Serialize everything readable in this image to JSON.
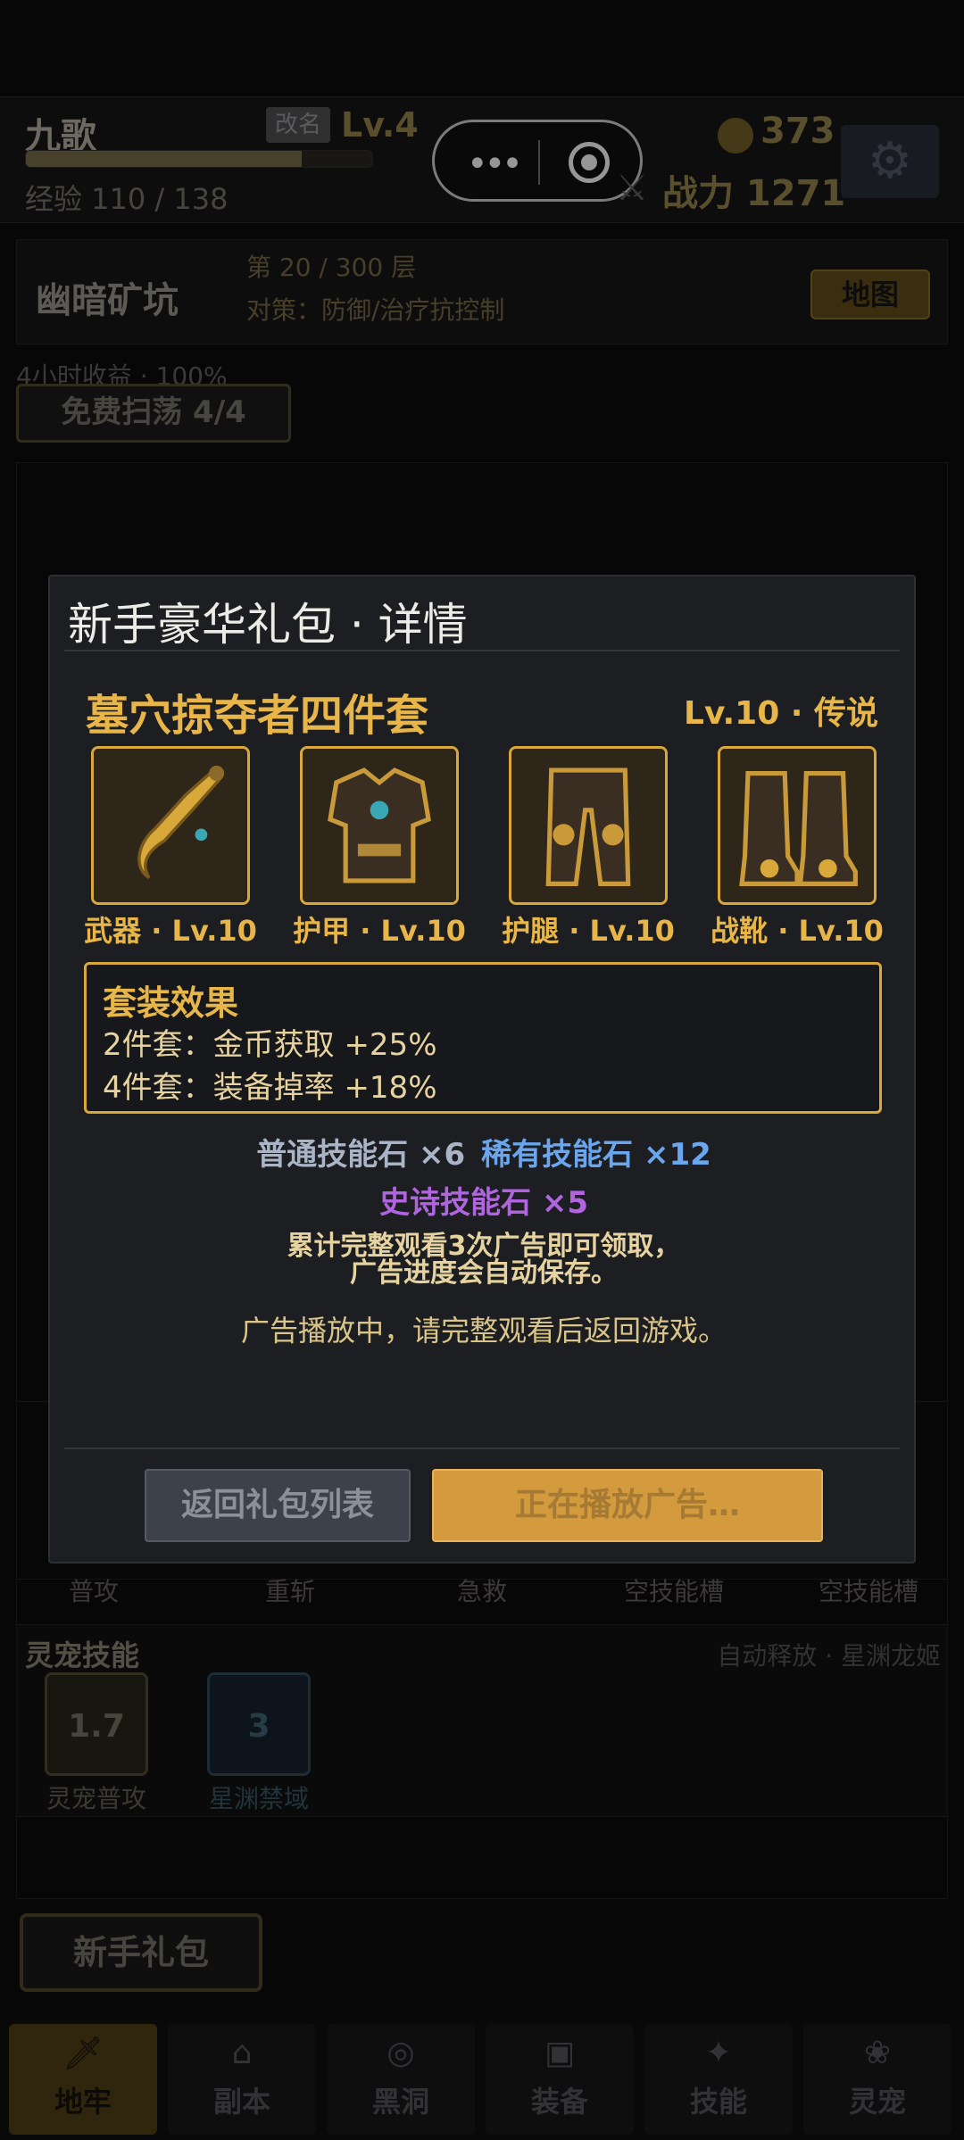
{
  "player": {
    "name": "九歌",
    "rename_label": "改名",
    "level": "Lv.4",
    "exp_text": "经验 110 / 138",
    "exp_ratio": 0.7971
  },
  "capsule": {
    "more": "•••",
    "close": "◎"
  },
  "coins": "373",
  "power": "战力 1271",
  "dungeon": {
    "name": "幽暗矿坑",
    "floor": "第 20 / 300 层",
    "strategy": "对策：防御/治疗抗控制",
    "map_label": "地图"
  },
  "income": "4小时收益 · 100%",
  "sweep_label": "免费扫荡 4/4",
  "skills": {
    "labels": [
      "普攻",
      "重斩",
      "急救",
      "空技能槽",
      "空技能槽"
    ]
  },
  "pet": {
    "title": "灵宠技能",
    "subtitle": "自动释放 · 星渊龙姬",
    "skill1_value": "1.7",
    "skill1_label": "灵宠普攻",
    "skill2_value": "3",
    "skill2_label": "星渊禁域"
  },
  "newbie_label": "新手礼包",
  "nav": [
    {
      "label": "地牢",
      "icon": "sword-icon"
    },
    {
      "label": "副本",
      "icon": "temple-icon"
    },
    {
      "label": "黑洞",
      "icon": "vortex-icon"
    },
    {
      "label": "装备",
      "icon": "bag-icon"
    },
    {
      "label": "技能",
      "icon": "star-icon"
    },
    {
      "label": "灵宠",
      "icon": "paw-icon"
    }
  ],
  "modal": {
    "title": "新手豪华礼包 · 详情",
    "set_name": "墓穴掠夺者四件套",
    "set_level": "Lv.10 · 传说",
    "items": [
      {
        "label": "武器 · Lv.10",
        "icon": "weapon-icon"
      },
      {
        "label": "护甲 · Lv.10",
        "icon": "armor-icon"
      },
      {
        "label": "护腿 · Lv.10",
        "icon": "leggings-icon"
      },
      {
        "label": "战靴 · Lv.10",
        "icon": "boots-icon"
      }
    ],
    "effect_title": "套装效果",
    "effect_2": "2件套：金币获取 +25%",
    "effect_4": "4件套：装备掉率 +18%",
    "stone_common": "普通技能石 ×6",
    "stone_rare": "稀有技能石 ×12",
    "stone_epic": "史诗技能石 ×5",
    "ad_note_1": "累计完整观看3次广告即可领取，",
    "ad_note_2": "广告进度会自动保存。",
    "ad_status": "广告播放中，请完整观看后返回游戏。",
    "back_label": "返回礼包列表",
    "play_label": "正在播放广告…"
  },
  "colors": {
    "gold": "#e8b548",
    "rare": "#6aa6ee",
    "epic": "#b164e0",
    "common": "#a9b4c6"
  }
}
